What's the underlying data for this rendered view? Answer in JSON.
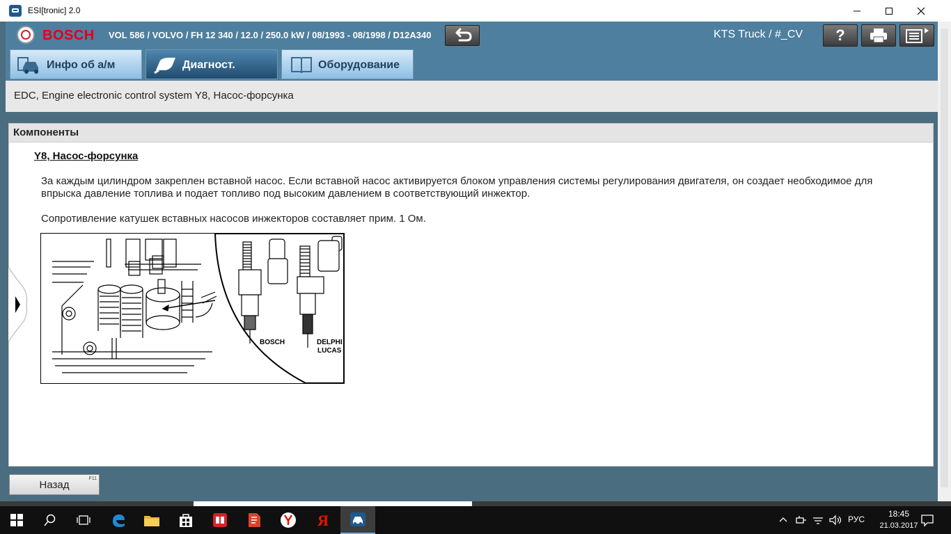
{
  "window": {
    "title": "ESI[tronic] 2.0",
    "minimize_icon": "minimize-icon",
    "maximize_icon": "maximize-icon",
    "close_icon": "close-icon"
  },
  "header": {
    "brand": "BOSCH",
    "vehicle": "VOL 586 / VOLVO / FH 12 340 / 12.0 / 250.0 kW / 08/1993 - 08/1998 / D12A340",
    "device": "KTS Truck / #_CV",
    "help_label": "?",
    "colors": {
      "brand_red": "#e2001a",
      "header_blue": "#4e7f9e"
    }
  },
  "tabs": [
    {
      "label": "Инфо об а/м",
      "icon": "car-info-icon",
      "active": false
    },
    {
      "label": "Диагност.",
      "icon": "diagnostic-plug-icon",
      "active": true
    },
    {
      "label": "Оборудование",
      "icon": "book-icon",
      "active": false
    }
  ],
  "path": "EDC, Engine electronic control system Y8, Насос-форсунка",
  "panel": {
    "heading": "Компоненты",
    "component_title": "Y8, Насос-форсунка",
    "description_1": "За каждым цилиндром закреплен вставной насос. Если вставной насос активируется блоком управления системы регулирования двигателя, он создает необходимое для впрыска давление топлива и подает топливо под высоким давлением в соответствующий инжектор.",
    "description_2": "Сопротивление катушек вставных насосов инжекторов составляет прим. 1 Ом.",
    "figure": {
      "label_bosch": "BOSCH",
      "label_delphi": "DELPHI",
      "label_lucas": "LUCAS"
    }
  },
  "footer": {
    "back_label": "Назад",
    "back_key": "F11"
  },
  "taskbar": {
    "lang": "РУС",
    "time": "18:45",
    "date": "21.03.2017"
  }
}
